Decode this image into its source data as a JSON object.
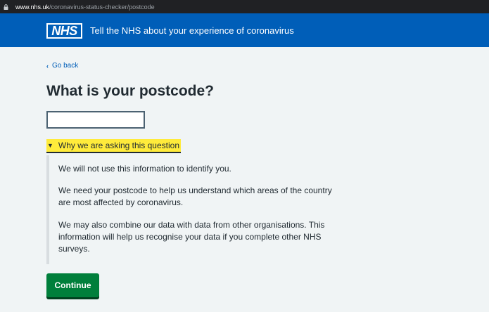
{
  "browser": {
    "url_domain": "www.nhs.uk",
    "url_path": "/coronavirus-status-checker/postcode"
  },
  "header": {
    "logo_text": "NHS",
    "service_name": "Tell the NHS about your experience of coronavirus",
    "brand_color": "#005eb8"
  },
  "back_link": {
    "label": "Go back"
  },
  "main": {
    "title": "What is your postcode?",
    "postcode_input": {
      "value": "",
      "placeholder": ""
    },
    "details": {
      "summary": "Why we are asking this question",
      "paragraphs": [
        "We will not use this information to identify you.",
        "We need your postcode to help us understand which areas of the country are most affected by coronavirus.",
        "We may also combine our data with data from other organisations. This information will help us recognise your data if you complete other NHS surveys."
      ]
    },
    "continue_label": "Continue",
    "button_color": "#007f3b"
  },
  "icons": {
    "lock": "lock-icon",
    "back": "chevron-left-icon",
    "disclosure": "triangle-down-icon"
  }
}
